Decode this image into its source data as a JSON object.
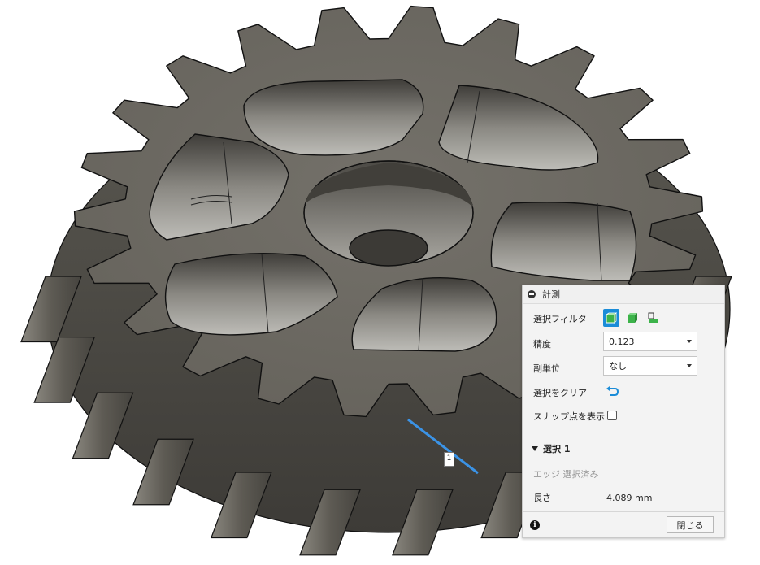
{
  "viewport": {
    "model": "helical-gear",
    "background": "#ffffff",
    "body_color": "#6b6860",
    "edge_color": "#111111",
    "highlight_color": "#3b93e6",
    "selected_edge_label": "1"
  },
  "panel": {
    "title": "計測",
    "selection_filter_label": "選択フィルタ",
    "selection_filter_icons": [
      "select-body-icon",
      "select-face-icon",
      "select-edge-icon"
    ],
    "precision_label": "精度",
    "precision_value": "0.123",
    "secondary_units_label": "副単位",
    "secondary_units_value": "なし",
    "clear_selection_label": "選択をクリア",
    "show_snap_points_label": "スナップ点を表示",
    "show_snap_points_checked": false,
    "selection_section_title": "選択 1",
    "selection_status": "エッジ 選択済み",
    "length_label": "長さ",
    "length_value": "4.089 mm",
    "close_label": "閉じる",
    "accent_color": "#1a8cd8"
  }
}
